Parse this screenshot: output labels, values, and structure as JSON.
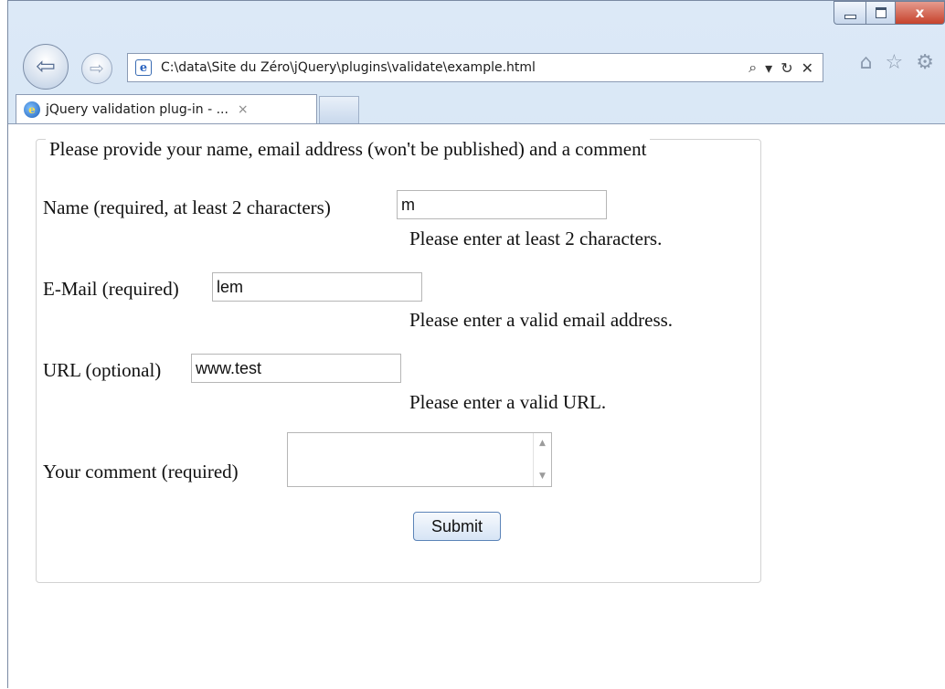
{
  "window": {
    "caption": {
      "close_symbol": "x"
    }
  },
  "toolbar": {
    "address": "C:\\data\\Site du Zéro\\jQuery\\plugins\\validate\\example.html",
    "address_tools": [
      "search-icon",
      "dropdown-icon",
      "refresh-icon",
      "stop-icon"
    ]
  },
  "tabs": [
    {
      "label": "jQuery validation plug-in - ...",
      "close": "×"
    }
  ],
  "form": {
    "legend": "Please provide your name, email address (won't be published) and a comment",
    "name": {
      "label": "Name (required, at least 2 characters)",
      "value": "m",
      "error": "Please enter at least 2 characters."
    },
    "email": {
      "label": "E-Mail (required)",
      "value": "lem",
      "error": "Please enter a valid email address."
    },
    "url": {
      "label": "URL (optional)",
      "value": "www.test",
      "error": "Please enter a valid URL."
    },
    "comment": {
      "label": "Your comment (required)",
      "value": ""
    },
    "submit_label": "Submit"
  }
}
